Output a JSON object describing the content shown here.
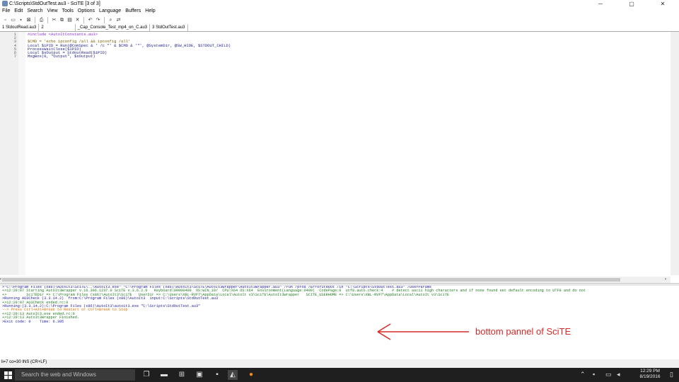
{
  "window": {
    "title": "C:\\Scripts\\StdOutTest.au3 - SciTE [3 of 3]",
    "controls": [
      "─",
      "▢",
      "✕"
    ]
  },
  "menu": [
    "File",
    "Edit",
    "Search",
    "View",
    "Tools",
    "Options",
    "Language",
    "Buffers",
    "Help"
  ],
  "toolbar": [
    "new-icon",
    "open-icon",
    "save-icon",
    "close-file-icon",
    "print-icon",
    "cut-icon",
    "copy-icon",
    "paste-icon",
    "delete-icon",
    "undo-icon",
    "redo-icon",
    "find-icon",
    "replace-icon"
  ],
  "tabs": [
    {
      "label": "1 StdoutRead.au3",
      "active": false
    },
    {
      "label": "2",
      "active": false
    },
    {
      "label": "_Cap_Console_Test_mp4_on_C.au3",
      "active": false
    },
    {
      "label": "3 StdOutTest.au3",
      "active": true
    }
  ],
  "editor": {
    "line_numbers": [
      "1",
      "2",
      "3",
      "4",
      "5",
      "6",
      "7"
    ],
    "lines": [
      "#include <AutoItConstants.au3>",
      "",
      "$CMD = 'echo ipconfig /all && ipconfig /all'",
      "Local $iPID = Run(@ComSpec & ' /c \"' & $CMD & '\"', @SystemDir, @SW_HIDE, $STDOUT_CHILD)",
      "ProcessWaitClose($iPID)",
      "Local $sOutput = StdoutRead($iPID)",
      "MsgBox(0, \"Output\", $sOutput)"
    ]
  },
  "output": {
    "lines": [
      {
        "text": ">\"C:\\Program Files (x86)\\AutoIt3\\SciTE\\..\\AutoIt3.exe\" \"C:\\Program Files (x86)\\AutoIt3\\SciTE\\AutoIt3Wrapper\\AutoIt3Wrapper.au3\" /run /prod /ErrorStdOut /in \"C:\\Scripts\\StdOutTest.au3\" /UserParams",
        "color": "#2020a0"
      },
      {
        "text": "+>12:29:07 Starting AutoIt3Wrapper v.16.306.1237.0 SciTE v.3.6.2.0   Keyboard:00000409  OS:WIN_10/  CPU:X64 OS:X64  Environment(Language:0409)  CodePage:0  utf8.auto.check:4    # detect ascii high characters and if none found set default encoding to UTF8 and do not",
        "color": "#207a20"
      },
      {
        "text": "+>         SciTEDir => C:\\Program Files (x86)\\AutoIt3\\SciTE   UserDir => C:\\Users\\XBL-RVF7\\AppData\\Local\\AutoIt v3\\SciTE\\AutoIt3Wrapper   SCITE_USERHOME => C:\\Users\\XBL-RVF7\\AppData\\Local\\AutoIt v3\\SciTE",
        "color": "#207a20"
      },
      {
        "text": ">Running AU3Check (3.3.14.2)  from:C:\\Program Files (x86)\\AutoIt3  input:C:\\Scripts\\StdOutTest.au3",
        "color": "#2020a0"
      },
      {
        "text": "+>12:29:07 AU3Check ended.rc:0",
        "color": "#207a20"
      },
      {
        "text": ">Running:(3.3.14.2):C:\\Program Files (x86)\\AutoIt3\\autoit3.exe \"C:\\Scripts\\StdOutTest.au3\"",
        "color": "#2020a0"
      },
      {
        "text": "--> Press Ctrl+Alt+Break to Restart or Ctrl+Break to Stop",
        "color": "#e07000"
      },
      {
        "text": "+>12:29:13 AutoIt3.exe ended.rc:0",
        "color": "#207a20"
      },
      {
        "text": "+>12:29:13 AutoIt3Wrapper Finished.",
        "color": "#207a20"
      },
      {
        "text": ">Exit code: 0    Time: 6.395",
        "color": "#2020a0"
      }
    ]
  },
  "annotation": {
    "text": "bottom pannel of SciTE",
    "color": "#d52a2a"
  },
  "status": "li=7 co=30 INS (CR+LF)",
  "taskbar": {
    "search_placeholder": "Search the web and Windows",
    "clock_time": "12:29 PM",
    "clock_date": "8/19/2016"
  }
}
